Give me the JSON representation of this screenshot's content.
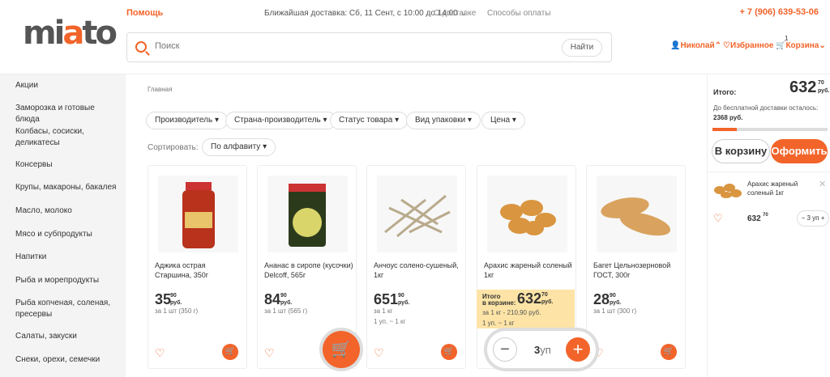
{
  "header": {
    "logo": "miato",
    "help": "Помощь",
    "delivery": "Ближайшая доставка: Сб, 11 Сент, с 10:00 до 14:00",
    "links": [
      "О доставке",
      "Способы оплаты"
    ],
    "phone": "+ 7 (906) 639-53-06",
    "search_placeholder": "Поиск",
    "search_button": "Найти",
    "user": "Николай",
    "favorites": "Избранное",
    "cart": "Корзина",
    "cart_count": "1"
  },
  "sidebar": {
    "items": [
      "Акции",
      "Заморозка и готовые блюда",
      "Колбасы, сосиски, деликатесы",
      "Консервы",
      "Крупы, макароны, бакалея",
      "Масло, молоко",
      "Мясо и субпродукты",
      "Напитки",
      "Рыба и морепродукты",
      "Рыба копченая, соленая, пресервы",
      "Салаты, закуски",
      "Снеки, орехи, семечки"
    ]
  },
  "main": {
    "breadcrumb": "Главная",
    "filters": [
      "Производитель",
      "Страна-производитель",
      "Статус товара",
      "Вид упаковки",
      "Цена"
    ],
    "sort_label": "Сортировать:",
    "sort_value": "По алфавиту",
    "products": [
      {
        "name": "Аджика острая Старшина, 350г",
        "price": "35",
        "kop": "90",
        "rub": "руб.",
        "unit": "за 1 шт (350 г)",
        "extra": ""
      },
      {
        "name": "Ананас в сиропе (кусочки) Delcoff, 565г",
        "price": "84",
        "kop": "90",
        "rub": "руб.",
        "unit": "за 1 шт (565 г)",
        "extra": ""
      },
      {
        "name": "Анчоус солено-сушеный, 1кг",
        "price": "651",
        "kop": "90",
        "rub": "руб.",
        "unit": "за 1 кг",
        "extra": "1 уп. ~ 1 кг"
      },
      {
        "name": "Арахис жареный соленый 1кг",
        "price": "632",
        "kop": "70",
        "rub": "руб.",
        "unit": "за 1 кг - 210,90 руб.",
        "extra": "1 уп. ~ 1 кг"
      },
      {
        "name": "Багет Цельнозерновой ГОСТ, 300г",
        "price": "28",
        "kop": "90",
        "rub": "руб.",
        "unit": "за 1 шт (300 г)",
        "extra": ""
      }
    ],
    "incart_label_1": "Итого",
    "incart_label_2": "в корзине:",
    "qty_value": "3",
    "qty_unit": "уп"
  },
  "cart_panel": {
    "total_label": "Итого:",
    "total": "632",
    "total_kop": "70",
    "total_rub": "руб.",
    "free_delivery_text": "До бесплатной доставки осталось:",
    "free_delivery_amount": "2368 руб.",
    "progress": 0.21,
    "btn_cart": "В корзину",
    "btn_order": "Оформить",
    "item_name": "Арахис жареный соленый 1кг",
    "item_price": "632",
    "item_kop": "70",
    "item_qty": "3 уп"
  },
  "colors": {
    "accent": "#f2642a",
    "sidebar_bg": "#f4f4f4",
    "incart_bg": "#fde4a6"
  }
}
